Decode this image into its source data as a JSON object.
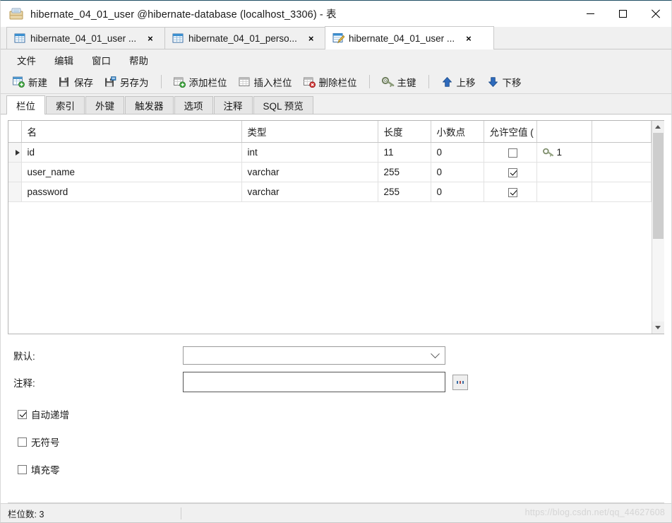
{
  "window": {
    "title": "hibernate_04_01_user @hibernate-database (localhost_3306) - 表",
    "icon": "table-window-icon",
    "controls": {
      "minimize": "minimize-icon",
      "maximize": "maximize-icon",
      "close": "close-icon"
    }
  },
  "tabs": [
    {
      "label": "hibernate_04_01_user ...",
      "icon": "table-icon",
      "active": false,
      "close": "×"
    },
    {
      "label": "hibernate_04_01_perso...",
      "icon": "table-icon",
      "active": false,
      "close": "×"
    },
    {
      "label": "hibernate_04_01_user ...",
      "icon": "table-design-icon",
      "active": true,
      "close": "×"
    }
  ],
  "menu": [
    {
      "label": "文件"
    },
    {
      "label": "编辑"
    },
    {
      "label": "窗口"
    },
    {
      "label": "帮助"
    }
  ],
  "toolbar": [
    {
      "label": "新建",
      "icon": "new-table-icon"
    },
    {
      "label": "保存",
      "icon": "save-icon"
    },
    {
      "label": "另存为",
      "icon": "save-as-icon"
    },
    {
      "sep": true
    },
    {
      "label": "添加栏位",
      "icon": "add-field-icon"
    },
    {
      "label": "插入栏位",
      "icon": "insert-field-icon"
    },
    {
      "label": "删除栏位",
      "icon": "delete-field-icon"
    },
    {
      "sep": true
    },
    {
      "label": "主键",
      "icon": "primary-key-icon"
    },
    {
      "sep": true
    },
    {
      "label": "上移",
      "icon": "arrow-up-icon"
    },
    {
      "label": "下移",
      "icon": "arrow-down-icon"
    }
  ],
  "subtabs": [
    {
      "label": "栏位",
      "active": true
    },
    {
      "label": "索引",
      "active": false
    },
    {
      "label": "外键",
      "active": false
    },
    {
      "label": "触发器",
      "active": false
    },
    {
      "label": "选项",
      "active": false
    },
    {
      "label": "注释",
      "active": false
    },
    {
      "label": "SQL 预览",
      "active": false
    }
  ],
  "grid": {
    "headers": [
      "名",
      "类型",
      "长度",
      "小数点",
      "允许空值 (",
      ""
    ],
    "rows": [
      {
        "selected": true,
        "name": "id",
        "type": "int",
        "length": "11",
        "decimals": "0",
        "nullable": false,
        "key": "1",
        "key_icon": "primary-key-icon"
      },
      {
        "selected": false,
        "name": "user_name",
        "type": "varchar",
        "length": "255",
        "decimals": "0",
        "nullable": true,
        "key": "",
        "key_icon": ""
      },
      {
        "selected": false,
        "name": "password",
        "type": "varchar",
        "length": "255",
        "decimals": "0",
        "nullable": true,
        "key": "",
        "key_icon": ""
      }
    ]
  },
  "properties": {
    "default_label": "默认:",
    "default_value": "",
    "comment_label": "注释:",
    "comment_value": "",
    "comment_button": "...",
    "checkboxes": [
      {
        "label": "自动递增",
        "checked": true
      },
      {
        "label": "无符号",
        "checked": false
      },
      {
        "label": "填充零",
        "checked": false
      }
    ]
  },
  "statusbar": {
    "field_count": "栏位数: 3",
    "watermark": "https://blog.csdn.net/qq_44627608"
  },
  "colors": {
    "title_accent": "#1f4e63",
    "toolbar_bg": "#f0f0f0",
    "grid_bg": "#ffffff",
    "arrow_blue": "#2e6bbd"
  }
}
